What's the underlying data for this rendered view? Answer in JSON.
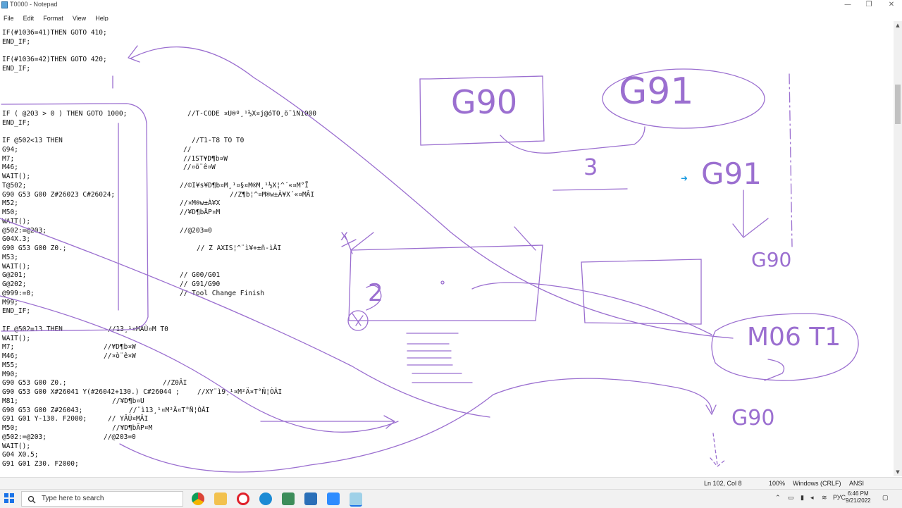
{
  "window": {
    "title": "T0000 - Notepad",
    "minimize": "—",
    "maximize": "❐",
    "close": "✕"
  },
  "menu": [
    "File",
    "Edit",
    "Format",
    "View",
    "Help"
  ],
  "code_lines": [
    "IF(#1036=41)THEN GOTO 410;",
    "END_IF;",
    "",
    "IF(#1036=42)THEN GOTO 420;",
    "END_IF;",
    "",
    "",
    "",
    "",
    "IF ( @203 > 0 ) THEN GOTO 1000;",
    "END_IF;",
    "",
    "IF @502<13 THEN",
    "G94;",
    "M7;",
    "M46;",
    "WAIT();",
    "T@502;",
    "G90 G53 G00 Z#26023 C#26024;",
    "M52;",
    "M50;",
    "WAIT();",
    "@502:=@203;",
    "G04X.3;",
    "G90 G53 G00 Z0.;",
    "M53;",
    "WAIT();",
    "G@201;",
    "G@202;",
    "@999:=0;",
    "M99;",
    "END_IF;",
    "",
    "IF @502=13 THEN",
    "WAIT();",
    "M7;",
    "M46;",
    "M55;",
    "M90;",
    "G90 G53 G00 Z0.;",
    "G90 G53 G00 X#26041 Y(#26042+130.) C#26044 ;",
    "M81;",
    "G90 G53 G00 Z#26043;",
    "G91 G01 Y-130. F2000;",
    "M50;",
    "@502:=@203;",
    "WAIT();",
    "G04 X0.5;",
    "G91 G01 Z30. F2000;"
  ],
  "comments": [
    {
      "line": 9,
      "text": "//T-CODE ¤U®º¸¹½X¤j@óT0¸ö¨ìN1000"
    },
    {
      "line": 12,
      "text": "//T1-T8 TO T0"
    },
    {
      "line": 13,
      "text": "//"
    },
    {
      "line": 14,
      "text": "//1ST¥D¶b¤W"
    },
    {
      "line": 15,
      "text": "//¤ö¨ê¤W"
    },
    {
      "line": 17,
      "text": "//©I¥s¥D¶b¤M¸¹¤§¤M®M¸¹½X¦^´«¤M°Ï"
    },
    {
      "line": 18,
      "text": "//Z¶b¦^¤M®w±À¥X´«¤MÂI"
    },
    {
      "line": 19,
      "text": "//¤M®w±À¥X"
    },
    {
      "line": 20,
      "text": "//¥D¶bÃP¤M"
    },
    {
      "line": 22,
      "text": "//@203=0"
    },
    {
      "line": 24,
      "text": "// Z AXIS¦^¨ì¥+±ñ-ìÂI"
    },
    {
      "line": 27,
      "text": "// G00/G01"
    },
    {
      "line": 28,
      "text": "// G91/G90"
    },
    {
      "line": 29,
      "text": "// Tool Change Finish"
    },
    {
      "line": 33,
      "text": "//13¸¹¤MÁÙ¤M T0"
    },
    {
      "line": 35,
      "text": "//¥D¶b¤W"
    },
    {
      "line": 36,
      "text": "//¤ò¨ê¤W"
    },
    {
      "line": 39,
      "text": "//Z0ÂI"
    },
    {
      "line": 40,
      "text": "//XY¨ì9¸¹¤M²Ä¤T°Ñ¦ÒÂI"
    },
    {
      "line": 41,
      "text": "//¥D¶b¤U"
    },
    {
      "line": 42,
      "text": "//¨ì13¸¹¤M²Ä¤T°Ñ¦ÒÂI"
    },
    {
      "line": 43,
      "text": "// YÂÚ¤MÂI"
    },
    {
      "line": 44,
      "text": "//¥D¶bÃP¤M"
    },
    {
      "line": 45,
      "text": "//@203=0"
    }
  ],
  "annotations": {
    "g90_box": "G90",
    "g91_oval": "G91",
    "three": "3",
    "g91_right": "G91",
    "g90_right": "G90",
    "x_mark": "X",
    "two_mark": "2",
    "m06_oval": "M06 T1",
    "g90_bottom": "G90",
    "arrow_blue": "➜"
  },
  "status": {
    "position": "Ln 102, Col 8",
    "zoom": "100%",
    "line_ending": "Windows (CRLF)",
    "encoding": "ANSI"
  },
  "taskbar": {
    "search_placeholder": "Type here to search",
    "language": "РУС",
    "time": "6:46 PM",
    "date": "9/21/2022"
  },
  "colors": {
    "ink": "#9b6fd0",
    "accent": "#1a73e8"
  }
}
